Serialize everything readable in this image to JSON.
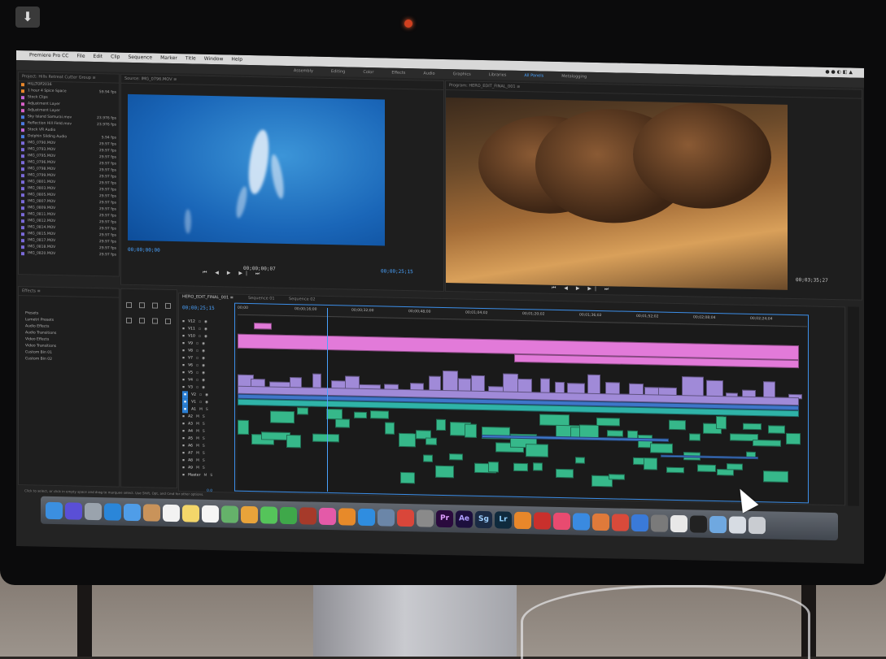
{
  "menubar": {
    "app": "Premiere Pro CC",
    "items": [
      "File",
      "Edit",
      "Clip",
      "Sequence",
      "Marker",
      "Title",
      "Window",
      "Help"
    ]
  },
  "workspace": {
    "tabs": [
      "Assembly",
      "Editing",
      "Color",
      "Effects",
      "Audio",
      "Graphics",
      "Libraries",
      "All Panels",
      "Metalogging"
    ],
    "active_index": 7
  },
  "project": {
    "tabs": "Project: Hills Retreat Cutter Group ≡",
    "rows": [
      {
        "name": "HILLTOP2016",
        "rate": ""
      },
      {
        "name": "1 hour 4 Spice Space",
        "rate": "59.94 fps"
      },
      {
        "name": "Stock Clips",
        "rate": ""
      },
      {
        "name": "Adjustment Layer",
        "rate": ""
      },
      {
        "name": "Adjustment Layer",
        "rate": ""
      },
      {
        "name": "Sky Island Samurai.mov",
        "rate": "23.976 fps"
      },
      {
        "name": "Reflection Hill Field.mov",
        "rate": "23.976 fps"
      },
      {
        "name": "Stock VR Audio",
        "rate": ""
      },
      {
        "name": "Dolphin Sliding Audio",
        "rate": "5.94 fps"
      },
      {
        "name": "IMG_0790.MOV",
        "rate": "29.97 fps"
      },
      {
        "name": "IMG_0793.MOV",
        "rate": "29.97 fps"
      },
      {
        "name": "IMG_0795.MOV",
        "rate": "29.97 fps"
      },
      {
        "name": "IMG_0796.MOV",
        "rate": "29.97 fps"
      },
      {
        "name": "IMG_0798.MOV",
        "rate": "29.97 fps"
      },
      {
        "name": "IMG_0799.MOV",
        "rate": "29.97 fps"
      },
      {
        "name": "IMG_0801.MOV",
        "rate": "29.97 fps"
      },
      {
        "name": "IMG_0803.MOV",
        "rate": "29.97 fps"
      },
      {
        "name": "IMG_0805.MOV",
        "rate": "29.97 fps"
      },
      {
        "name": "IMG_0807.MOV",
        "rate": "29.97 fps"
      },
      {
        "name": "IMG_0809.MOV",
        "rate": "29.97 fps"
      },
      {
        "name": "IMG_0811.MOV",
        "rate": "29.97 fps"
      },
      {
        "name": "IMG_0812.MOV",
        "rate": "29.97 fps"
      },
      {
        "name": "IMG_0814.MOV",
        "rate": "29.97 fps"
      },
      {
        "name": "IMG_0815.MOV",
        "rate": "29.97 fps"
      },
      {
        "name": "IMG_0817.MOV",
        "rate": "29.97 fps"
      },
      {
        "name": "IMG_0818.MOV",
        "rate": "29.97 fps"
      },
      {
        "name": "IMG_0820.MOV",
        "rate": "29.97 fps"
      }
    ]
  },
  "effects": {
    "tabs": "Effects ≡",
    "items": [
      "Presets",
      "Lumetri Presets",
      "Audio Effects",
      "Audio Transitions",
      "Video Effects",
      "Video Transitions",
      "Custom Bin 01",
      "Custom Bin 02"
    ]
  },
  "source": {
    "tabs": "Source: IMG_0796.MOV ≡",
    "timecode": "00;00;00;00",
    "duration": "00;00;00;07"
  },
  "program": {
    "tabs": "Program: HERO_EDIT_FINAL_001 ≡",
    "timecode": "00;00;25;15",
    "duration": "00;03;35;27"
  },
  "timeline": {
    "sequence_tab": "HERO_EDIT_FINAL_001 ≡",
    "tab2": "Sequence 01",
    "tab3": "Sequence 02",
    "timecode": "00;00;25;15",
    "ruler": [
      "00;00",
      "00;00;16;00",
      "00;00;32;00",
      "00;00;48;00",
      "00;01;04;02",
      "00;01;20;02",
      "00;01;36;02",
      "00;01;52;02",
      "00;02;08;04",
      "00;02;24;04"
    ],
    "video_tracks": [
      "V12",
      "V11",
      "V10",
      "V9",
      "V8",
      "V7",
      "V6",
      "V5",
      "V4",
      "V3",
      "V2",
      "V1"
    ],
    "audio_tracks": [
      "A1",
      "A2",
      "A3",
      "A4",
      "A5",
      "A6",
      "A7",
      "A8",
      "A9",
      "Master"
    ],
    "master_value": "0.0"
  },
  "status": "Click to select, or click in empty space and drag to marquee select. Use Shift, Opt, and Cmd for other options.",
  "dock": [
    {
      "name": "finder",
      "label": "",
      "color": "#3b8fe0"
    },
    {
      "name": "siri",
      "label": "",
      "color": "#5a4fd6"
    },
    {
      "name": "launchpad",
      "label": "",
      "color": "#9aa3ad"
    },
    {
      "name": "safari",
      "label": "",
      "color": "#2a86d9"
    },
    {
      "name": "mail",
      "label": "",
      "color": "#4f9de8"
    },
    {
      "name": "contacts",
      "label": "",
      "color": "#c9935a"
    },
    {
      "name": "calendar",
      "label": "",
      "color": "#f2f2f2"
    },
    {
      "name": "notes",
      "label": "",
      "color": "#f3d66a"
    },
    {
      "name": "reminders",
      "label": "",
      "color": "#f5f5f5"
    },
    {
      "name": "maps",
      "label": "",
      "color": "#65b26a"
    },
    {
      "name": "photos",
      "label": "",
      "color": "#e8a33a"
    },
    {
      "name": "messages",
      "label": "",
      "color": "#55c45a"
    },
    {
      "name": "facetime",
      "label": "",
      "color": "#3fa84a"
    },
    {
      "name": "photo-booth",
      "label": "",
      "color": "#a63a2a"
    },
    {
      "name": "itunes",
      "label": "",
      "color": "#e45aa8"
    },
    {
      "name": "ibooks",
      "label": "",
      "color": "#e78a2a"
    },
    {
      "name": "app-store",
      "label": "",
      "color": "#2f8de0"
    },
    {
      "name": "preview",
      "label": "",
      "color": "#6b86a8"
    },
    {
      "name": "chrome",
      "label": "",
      "color": "#d9463a"
    },
    {
      "name": "system-prefs",
      "label": "",
      "color": "#8a8a8a"
    },
    {
      "name": "premiere-pro",
      "label": "Pr",
      "color": "#2a0a3d"
    },
    {
      "name": "after-effects",
      "label": "Ae",
      "color": "#1c0f3d"
    },
    {
      "name": "speedgrade",
      "label": "Sg",
      "color": "#1a2a44"
    },
    {
      "name": "lightroom",
      "label": "Lr",
      "color": "#0f2a3d"
    },
    {
      "name": "vlc",
      "label": "",
      "color": "#e8872a"
    },
    {
      "name": "acrobat",
      "label": "",
      "color": "#c9302c"
    },
    {
      "name": "music",
      "label": "",
      "color": "#e84b70"
    },
    {
      "name": "keynote",
      "label": "",
      "color": "#3a8ae0"
    },
    {
      "name": "handbrake",
      "label": "",
      "color": "#e07a3a"
    },
    {
      "name": "sketchup",
      "label": "",
      "color": "#d94a3a"
    },
    {
      "name": "xcode",
      "label": "",
      "color": "#3a7ad9"
    },
    {
      "name": "utilities",
      "label": "",
      "color": "#7a7a7a"
    },
    {
      "name": "document",
      "label": "",
      "color": "#e8e8e8"
    },
    {
      "name": "terminal",
      "label": "",
      "color": "#222222"
    },
    {
      "name": "downloads-stack",
      "label": "",
      "color": "#6fa8e0"
    },
    {
      "name": "documents-stack",
      "label": "",
      "color": "#d7dce3"
    },
    {
      "name": "trash",
      "label": "",
      "color": "#c9ccd1"
    }
  ],
  "colors": {
    "accent": "#4aa3ff",
    "clip_pink": "#e27ad9",
    "clip_violet": "#a08ad8",
    "clip_teal": "#36b88a"
  }
}
